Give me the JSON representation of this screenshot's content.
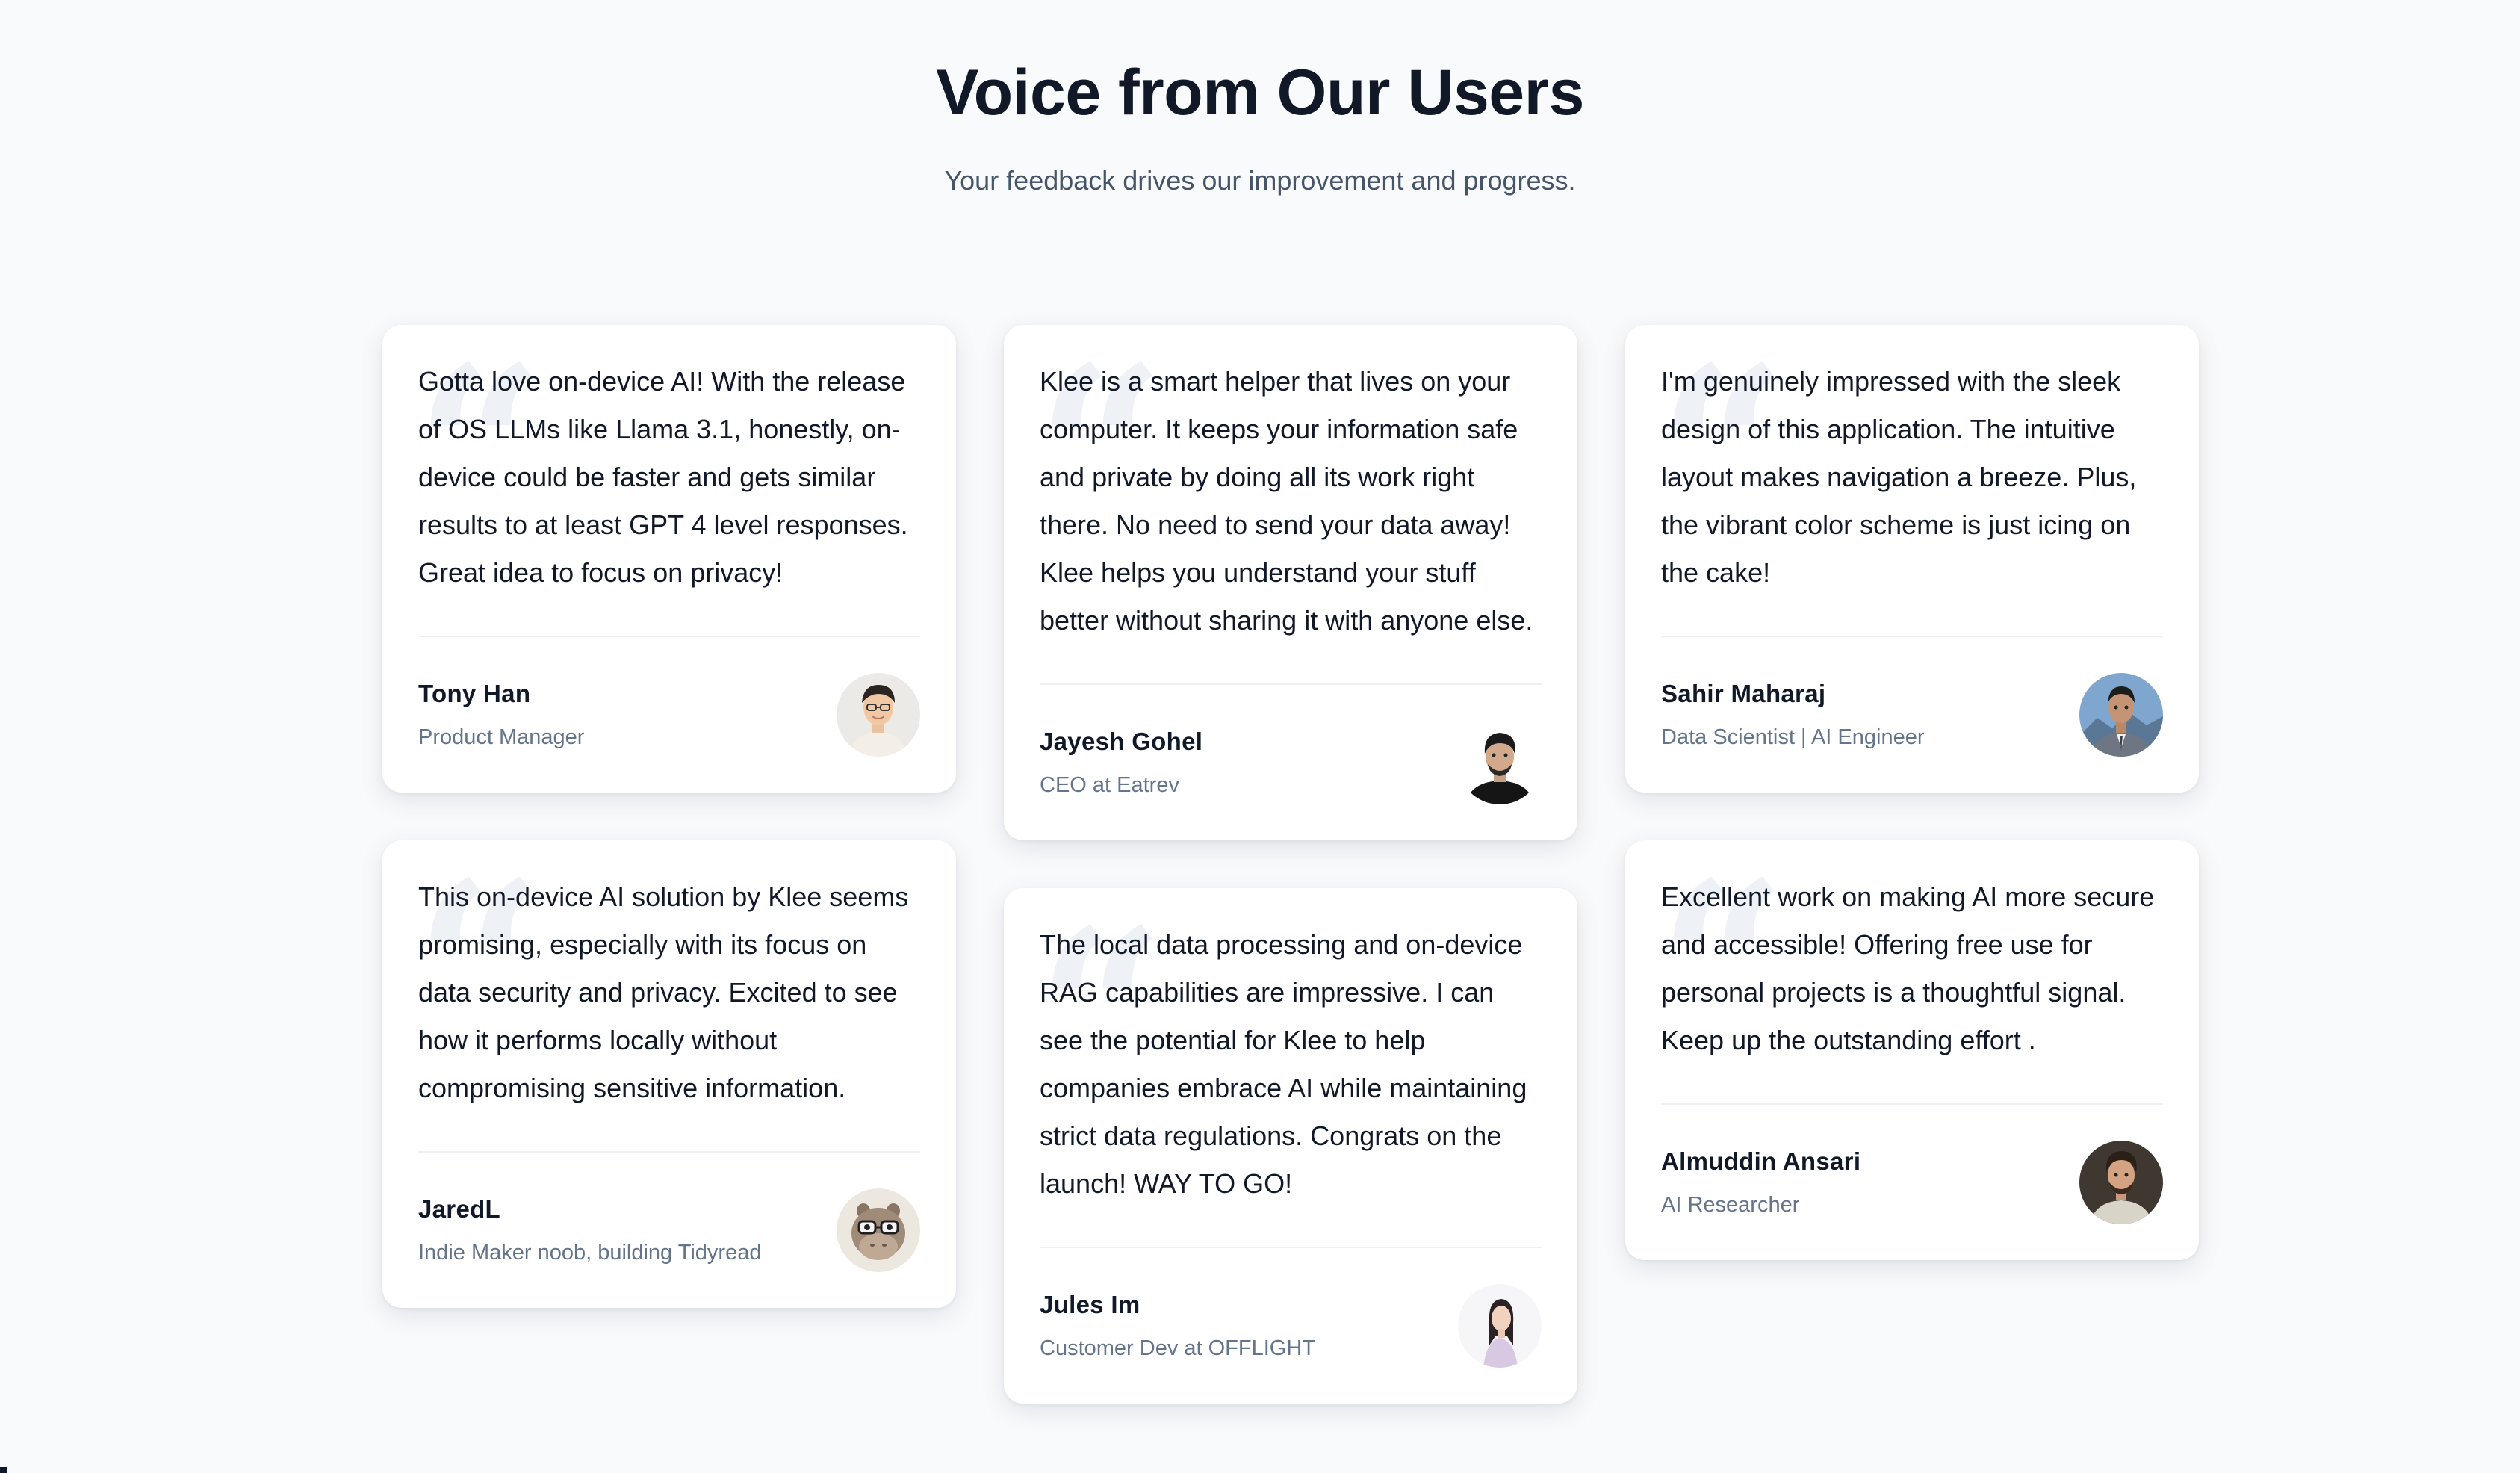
{
  "header": {
    "title": "Voice from Our Users",
    "subtitle": "Your feedback drives our improvement and progress."
  },
  "testimonials": [
    {
      "text": "Gotta love on-device AI! With the release of OS LLMs like Llama 3.1, honestly, on-device could be faster and gets similar results to at least GPT 4 level responses. Great idea to focus on privacy!",
      "name": "Tony Han",
      "role": "Product Manager",
      "avatar": "avatar-icon"
    },
    {
      "text": "Klee is a smart helper that lives on your computer. It keeps your information safe and private by doing all its work right there. No need to send your data away! Klee helps you understand your stuff better without sharing it with anyone else.",
      "name": "Jayesh Gohel",
      "role": "CEO at Eatrev",
      "avatar": "avatar-icon"
    },
    {
      "text": "I'm genuinely impressed with the sleek design of this application. The intuitive layout makes navigation a breeze. Plus, the vibrant color scheme is just icing on the cake!",
      "name": "Sahir Maharaj",
      "role": "Data Scientist | AI Engineer",
      "avatar": "avatar-icon"
    },
    {
      "text": "This on-device AI solution by Klee seems promising, especially with its focus on data security and privacy. Excited to see how it performs locally without compromising sensitive information.",
      "name": "JaredL",
      "role": "Indie Maker noob, building Tidyread",
      "avatar": "avatar-icon"
    },
    {
      "text": "The local data processing and on-device RAG capabilities are impressive. I can see the potential for Klee to help companies embrace AI while maintaining strict data regulations. Congrats on the launch! WAY TO GO!",
      "name": "Jules Im",
      "role": "Customer Dev at OFFLIGHT",
      "avatar": "avatar-icon"
    },
    {
      "text": "Excellent work on making AI more secure and accessible! Offering free use for personal projects is a thoughtful signal. Keep up the outstanding effort .",
      "name": "Almuddin Ansari",
      "role": "AI Researcher",
      "avatar": "avatar-icon"
    }
  ],
  "colors": {
    "background": "#f8fafc",
    "card": "#ffffff",
    "title": "#111827",
    "muted": "#64748b"
  }
}
